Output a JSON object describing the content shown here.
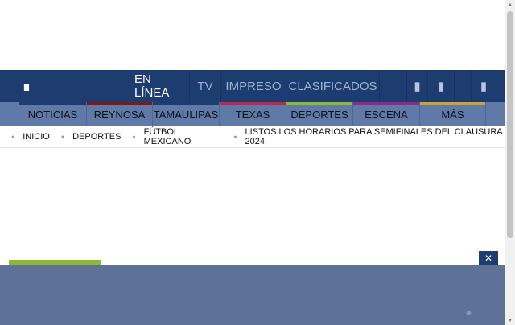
{
  "topnav": {
    "menu_icon": "menu-icon",
    "items": [
      {
        "label": "EN LÍNEA",
        "active": true
      },
      {
        "label": "TV"
      },
      {
        "label": "IMPRESO"
      },
      {
        "label": "CLASIFICADOS"
      }
    ],
    "icons": [
      "facebook-icon",
      "twitter-icon",
      "user-icon",
      "search-icon"
    ]
  },
  "sections": [
    {
      "label": "NOTICIAS",
      "color": "#1d3c6f"
    },
    {
      "label": "REYNOSA",
      "color": "#7a1a1a"
    },
    {
      "label": "TAMAULIPAS",
      "color": "#1d3c6f"
    },
    {
      "label": "TEXAS",
      "color": "#c0284b"
    },
    {
      "label": "DEPORTES",
      "color": "#8dba35"
    },
    {
      "label": "ESCENA",
      "color": "#8a2c8c"
    },
    {
      "label": "MÁS",
      "color": "#c9a23a"
    }
  ],
  "breadcrumb": [
    "INICIO",
    "DEPORTES",
    "FÚTBOL MEXICANO",
    "LISTOS LOS HORARIOS PARA SEMIFINALES DEL CLAUSURA 2024"
  ],
  "overlay": {
    "close_label": "✕"
  },
  "colors": {
    "primary": "#1d3c6f",
    "secondary": "#5f7aa6",
    "accent": "#8dba35"
  }
}
